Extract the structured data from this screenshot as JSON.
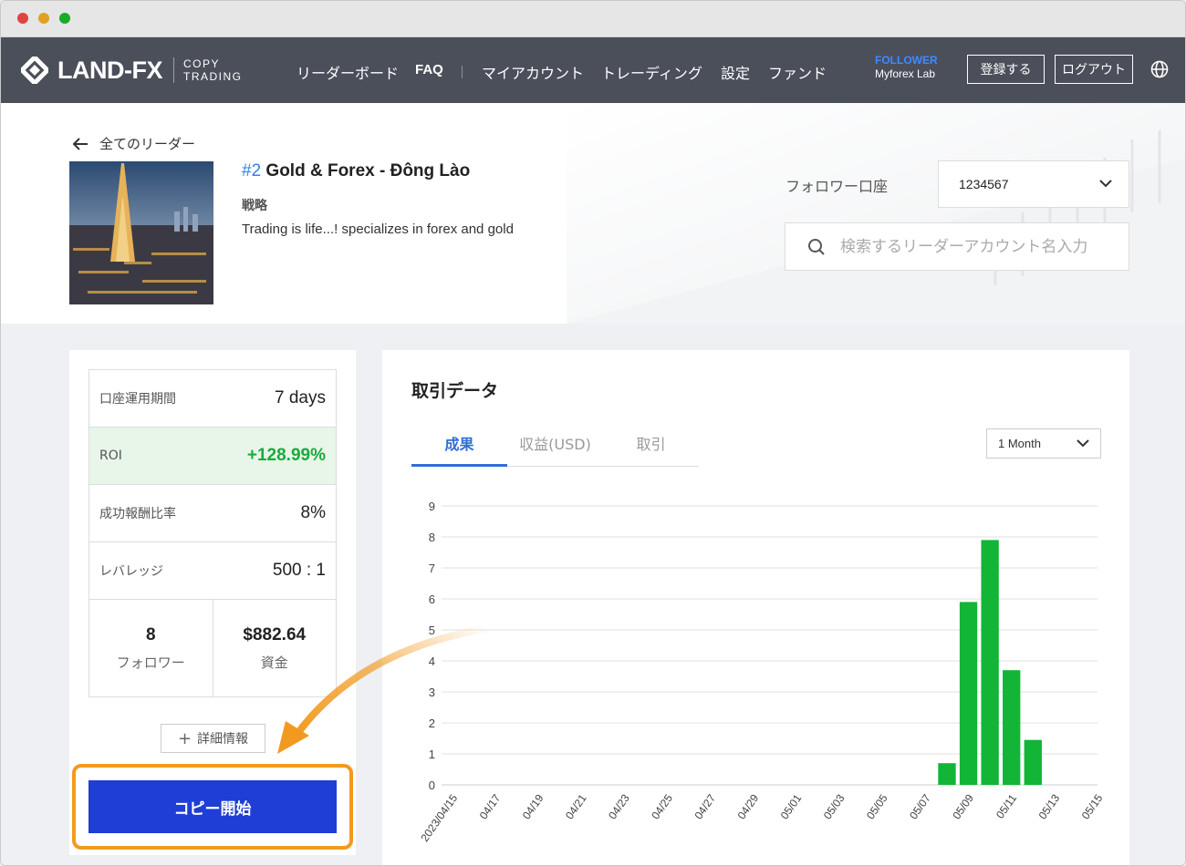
{
  "window": {
    "controls": [
      "close",
      "minimize",
      "maximize"
    ]
  },
  "nav": {
    "logo_text": "LAND-FX",
    "logo_sub_1": "COPY",
    "logo_sub_2": "TRADING",
    "items": [
      "リーダーボード",
      "FAQ",
      "マイアカウント",
      "トレーディング",
      "設定",
      "ファンド"
    ],
    "follower_label": "FOLLOWER",
    "follower_name": "Myforex Lab",
    "register_label": "登録する",
    "logout_label": "ログアウト",
    "globe_icon": "globe-icon"
  },
  "header": {
    "back_label": "全てのリーダー",
    "rank": "#2",
    "leader_name": "Gold & Forex - Đông Lào",
    "strategy_label": "戦略",
    "strategy_text": "Trading is life...! specializes in forex and gold",
    "account_label": "フォロワー口座",
    "account_value": "1234567",
    "search_placeholder": "検索するリーダーアカウント名入力"
  },
  "stats": {
    "period_label": "口座運用期間",
    "period_value": "7 days",
    "roi_label": "ROI",
    "roi_value": "+128.99%",
    "fee_label": "成功報酬比率",
    "fee_value": "8%",
    "leverage_label": "レバレッジ",
    "leverage_value": "500 : 1",
    "followers_value": "8",
    "followers_label": "フォロワー",
    "funds_value": "$882.64",
    "funds_label": "資金",
    "detail_label": "詳細情報",
    "copy_label": "コピー開始"
  },
  "trading": {
    "title": "取引データ",
    "tabs": [
      "成果",
      "収益(USD)",
      "取引"
    ],
    "active_tab": 0,
    "range": "1 Month"
  },
  "colors": {
    "nav_bg": "#4b4f5a",
    "accent_blue": "#1e3ed6",
    "roi_green": "#1aab3c",
    "bar_green": "#12b536",
    "highlight_orange": "#f29a1f"
  },
  "chart_data": {
    "type": "bar",
    "x": [
      "2023/04/15",
      "04/16",
      "04/17",
      "04/18",
      "04/19",
      "04/20",
      "04/21",
      "04/22",
      "04/23",
      "04/24",
      "04/25",
      "04/26",
      "04/27",
      "04/28",
      "04/29",
      "04/30",
      "05/01",
      "05/02",
      "05/03",
      "05/04",
      "05/05",
      "05/06",
      "05/07",
      "05/08",
      "05/09",
      "05/10",
      "05/11",
      "05/12",
      "05/13",
      "05/14",
      "05/15"
    ],
    "values": [
      0,
      0,
      0,
      0,
      0,
      0,
      0,
      0,
      0,
      0,
      0,
      0,
      0,
      0,
      0,
      0,
      0,
      0,
      0,
      0,
      0,
      0,
      0,
      0.7,
      5.9,
      7.9,
      3.7,
      1.45,
      0,
      0,
      0
    ],
    "x_tick_labels": [
      "2023/04/15",
      "04/17",
      "04/19",
      "04/21",
      "04/23",
      "04/25",
      "04/27",
      "04/29",
      "05/01",
      "05/03",
      "05/05",
      "05/07",
      "05/09",
      "05/11",
      "05/13",
      "05/15"
    ],
    "y_ticks": [
      "0",
      "1",
      "2",
      "3",
      "4",
      "5",
      "6",
      "7",
      "8",
      "9"
    ],
    "ylim": [
      0,
      9
    ],
    "grid": true
  }
}
